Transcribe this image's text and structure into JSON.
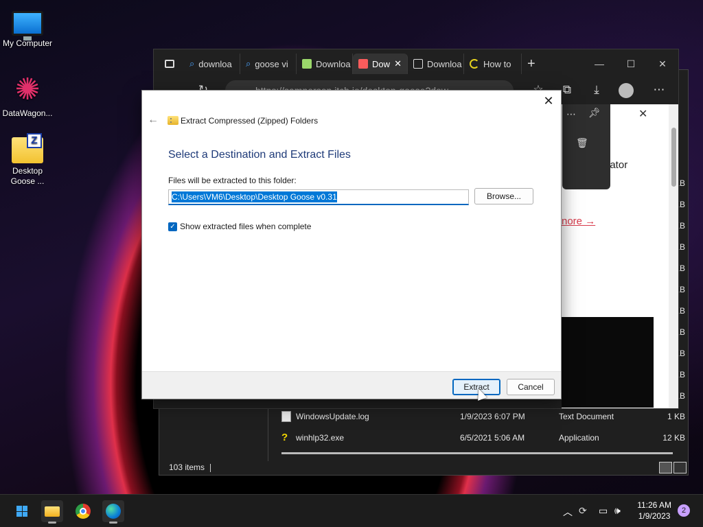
{
  "desktop": {
    "icons": [
      {
        "label": "My Computer",
        "icon": "monitor-icon"
      },
      {
        "label": "DataWagon...",
        "icon": "datawagon-icon"
      },
      {
        "label": "Desktop Goose ...",
        "icon": "zip-folder-icon"
      }
    ]
  },
  "explorer": {
    "files": [
      {
        "name": "WindowsUpdate.log",
        "date": "1/9/2023 6:07 PM",
        "type": "Text Document",
        "size": "1 KB",
        "icon": "text-file-icon"
      },
      {
        "name": "winhlp32.exe",
        "date": "6/5/2021 5:06 AM",
        "type": "Application",
        "size": "12 KB",
        "icon": "help-app-icon"
      }
    ],
    "size_column": [
      "KB",
      "KB",
      "KB",
      "KB",
      "KB",
      "KB",
      "KB",
      "KB",
      "KB",
      "KB",
      "KB"
    ],
    "status": "103 items"
  },
  "browser": {
    "tabs": [
      {
        "label": "downloa",
        "icon": "search-icon"
      },
      {
        "label": "goose vi",
        "icon": "search-icon"
      },
      {
        "label": "Downloa",
        "icon": "itch-icon"
      },
      {
        "label": "Dow",
        "icon": "itch-store-icon"
      },
      {
        "label": "Downloa",
        "icon": "page-icon"
      },
      {
        "label": "How to",
        "icon": "loading-icon"
      }
    ],
    "new_tab": "+",
    "url": "https://samperson.itch.io/desktop-goose?dow",
    "web_text_1": "eator",
    "web_link": "nore →"
  },
  "dialog": {
    "title": "Extract Compressed (Zipped) Folders",
    "heading": "Select a Destination and Extract Files",
    "path_label": "Files will be extracted to this folder:",
    "path_value": "C:\\Users\\VM6\\Desktop\\Desktop Goose v0.31",
    "browse": "Browse...",
    "checkbox_label": "Show extracted files when complete",
    "checkbox_checked": true,
    "extract": "Extract",
    "cancel": "Cancel"
  },
  "taskbar": {
    "time": "11:26 AM",
    "date": "1/9/2023",
    "notifications": "2"
  }
}
